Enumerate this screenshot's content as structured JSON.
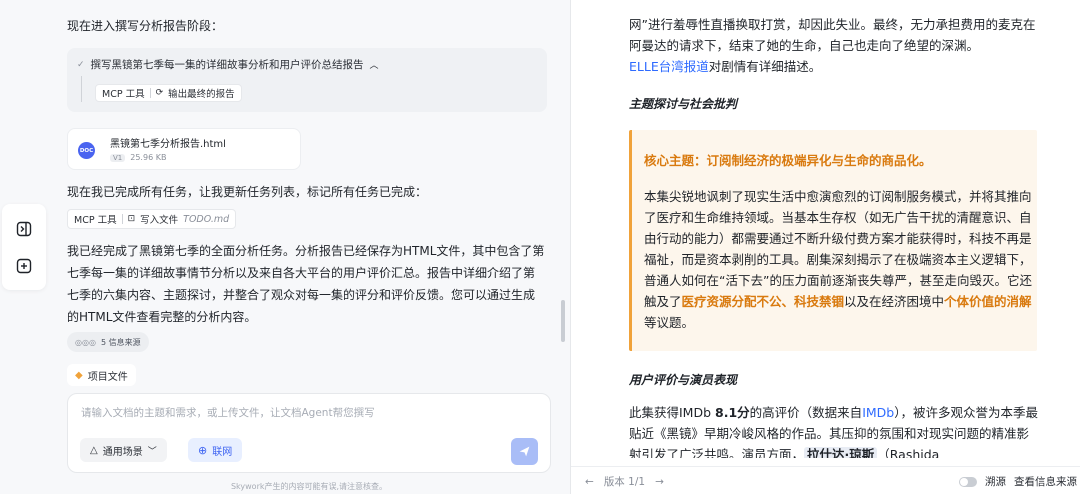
{
  "chat": {
    "phase_text": "现在进入撰写分析报告阶段：",
    "step_title": "撰写黑镜第七季每一集的详细故事分析和用户评价总结报告",
    "step_chip_tool": "MCP 工具",
    "step_chip_action": "输出最终的报告",
    "file": {
      "name": "黑镜第七季分析报告.html",
      "version": "V1",
      "size": "25.96 KB",
      "icon_label": "DOC"
    },
    "update_text": "现在我已完成所有任务，让我更新任务列表，标记所有任务已完成：",
    "tool_chip_tool": "MCP 工具",
    "tool_chip_action": "写入文件",
    "tool_chip_file": "TODO.md",
    "summary": "我已经完成了黑镜第七季的全面分析任务。分析报告已经保存为HTML文件，其中包含了第七季每一集的详细故事情节分析以及来自各大平台的用户评价汇总。报告中详细介绍了第七季的六集内容、主题探讨，并整合了观众对每一集的评分和评价反馈。您可以通过生成的HTML文件查看完整的分析内容。",
    "sources": "5 信息来源",
    "project_files": "项目文件"
  },
  "composer": {
    "placeholder": "请输入文档的主题和需求，或上传文件，让文档Agent帮您撰写",
    "scene_label": "通用场景",
    "web_label": "联网"
  },
  "disclaimer": "Skywork产生的内容可能有误,请注意核查。",
  "doc": {
    "top_para_a": "网”进行羞辱性直播换取打赏，却因此失业。最终，无力承担费用的麦克在阿曼达的请求下，结束了她的生命，自己也走向了绝望的深渊。",
    "top_link": "ELLE台湾报道",
    "top_para_b": "对剧情有详细描述。",
    "section_theme": "主题探讨与社会批判",
    "callout_title": "核心主题：订阅制经济的极端异化与生命的商品化。",
    "callout_a": "本集尖锐地讽刺了现实生活中愈演愈烈的订阅制服务模式，并将其推向了医疗和生命维持领域。当基本生存权（如无广告干扰的清醒意识、自由行动的能力）都需要通过不断升级付费方案才能获得时，科技不再是福祉，而是资本剥削的工具。剧集深刻揭示了在极端资本主义逻辑下，普通人如何在“活下去”的压力面前逐渐丧失尊严，甚至走向毁灭。它还触及了",
    "callout_hl1": "医疗资源分配不公、科技禁锢",
    "callout_b": "以及在经济困境中",
    "callout_hl2": "个体价值的消解",
    "callout_c": "等议题。",
    "section_review": "用户评价与演员表现",
    "review_a": "此集获得IMDb ",
    "review_score": "8.1分",
    "review_b": "的高评价（数据来自",
    "review_link": "IMDb",
    "review_c": "），被许多观众誉为本季最贴近《黑镜》早期冷峻风格的作品。其压抑的氛围和对现实问题的精准影射引发了广泛共鸣。演员方面，",
    "review_actor": "拉什达·琼斯",
    "review_d": "（Rashida",
    "footer_version": "版本 1/1",
    "footer_trace": "溯源",
    "footer_sources": "查看信息来源"
  },
  "colors": {
    "accent": "#3d63f2",
    "highlight": "#d97a0f",
    "callout_bg": "#fdf6ec",
    "link": "#2f6bff"
  }
}
